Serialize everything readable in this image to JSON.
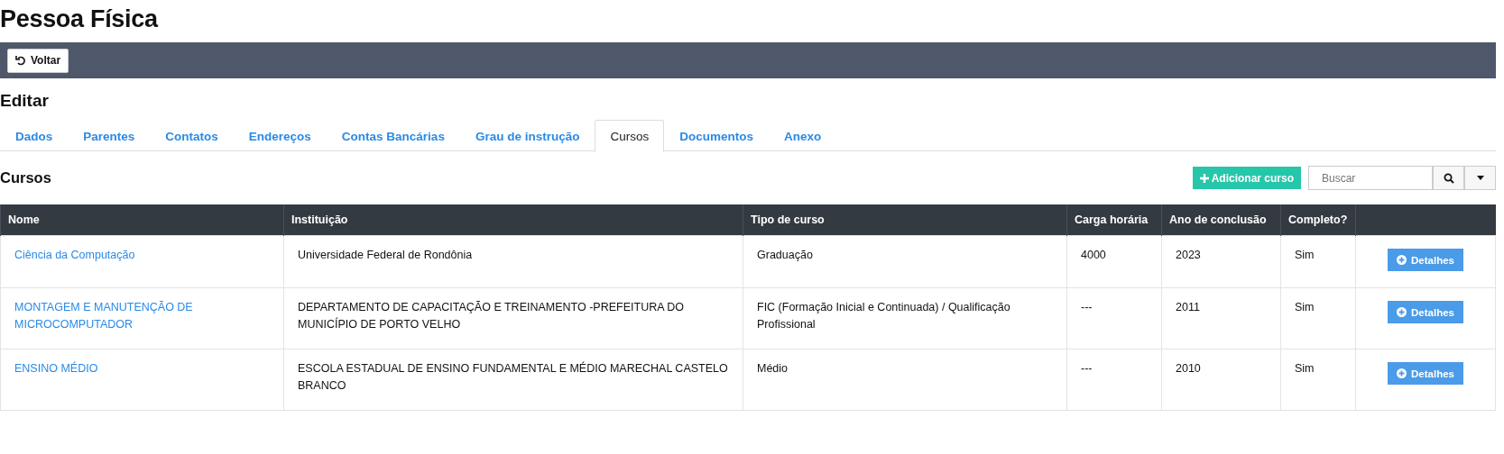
{
  "page": {
    "title": "Pessoa Física"
  },
  "toolbar": {
    "back_button": "Voltar"
  },
  "section_title": "Editar",
  "tabs": [
    {
      "label": "Dados",
      "selected": false
    },
    {
      "label": "Parentes",
      "selected": false
    },
    {
      "label": "Contatos",
      "selected": false
    },
    {
      "label": "Endereços",
      "selected": false
    },
    {
      "label": "Contas Bancárias",
      "selected": false
    },
    {
      "label": "Grau de instrução",
      "selected": false
    },
    {
      "label": "Cursos",
      "selected": true
    },
    {
      "label": "Documentos",
      "selected": false
    },
    {
      "label": "Anexo",
      "selected": false
    }
  ],
  "panel": {
    "title": "Cursos",
    "add_button": "Adicionar curso",
    "search": {
      "placeholder": "Buscar"
    }
  },
  "table": {
    "columns": [
      "Nome",
      "Instituição",
      "Tipo de curso",
      "Carga horária",
      "Ano de conclusão",
      "Completo?"
    ],
    "rows": [
      {
        "name": "Ciência da Computação",
        "institution": "Universidade Federal de Rondônia",
        "type": "Graduação",
        "hours": "4000",
        "year": "2023",
        "complete": "Sim",
        "action": "Detalhes"
      },
      {
        "name": "MONTAGEM E MANUTENÇÃO DE MICROCOMPUTADOR",
        "institution": "DEPARTAMENTO DE CAPACITAÇÃO E TREINAMENTO -PREFEITURA DO MUNICÍPIO DE PORTO VELHO",
        "type": "FIC (Formação Inicial e Continuada) / Qualificação Profissional",
        "hours": "---",
        "year": "2011",
        "complete": "Sim",
        "action": "Detalhes"
      },
      {
        "name": "ENSINO MÉDIO",
        "institution": "ESCOLA ESTADUAL DE ENSINO FUNDAMENTAL E MÉDIO MARECHAL CASTELO BRANCO",
        "type": "Médio",
        "hours": "---",
        "year": "2010",
        "complete": "Sim",
        "action": "Detalhes"
      }
    ]
  }
}
